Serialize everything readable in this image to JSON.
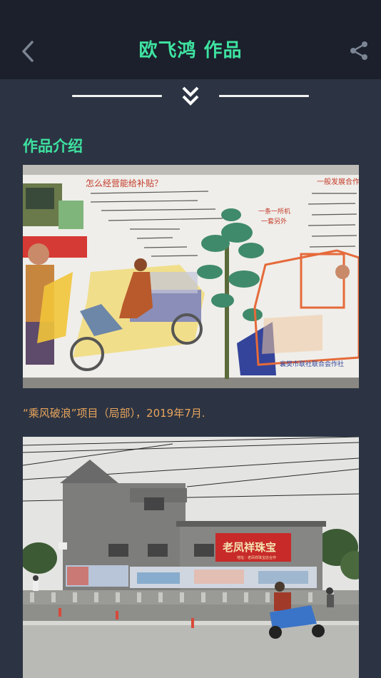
{
  "header": {
    "title": "欧飞鸿 作品",
    "back_icon": "chevron-left-icon",
    "share_icon": "share-icon"
  },
  "divider": {
    "icon": "double-chevron-down-icon"
  },
  "section": {
    "title": "作品介绍"
  },
  "artworks": [
    {
      "mural_text": {
        "headline": "怎么经营能给补贴？",
        "right_heading": "一般发展合作",
        "stamp_line1": "一条一所机",
        "stamp_line2": "一套另外",
        "bottom_sign": "襄樊市联社联合会作社"
      },
      "caption": "“乘风破浪”项目（局部），2019年7月."
    },
    {
      "sign_text": "老凤祥珠宝",
      "sign_sub": "地址：老凤祥珠宝店合作"
    }
  ],
  "colors": {
    "accent": "#3ee2a0",
    "caption": "#e8a45c",
    "header_bg": "#1b202c",
    "page_bg": "#2c3443"
  }
}
